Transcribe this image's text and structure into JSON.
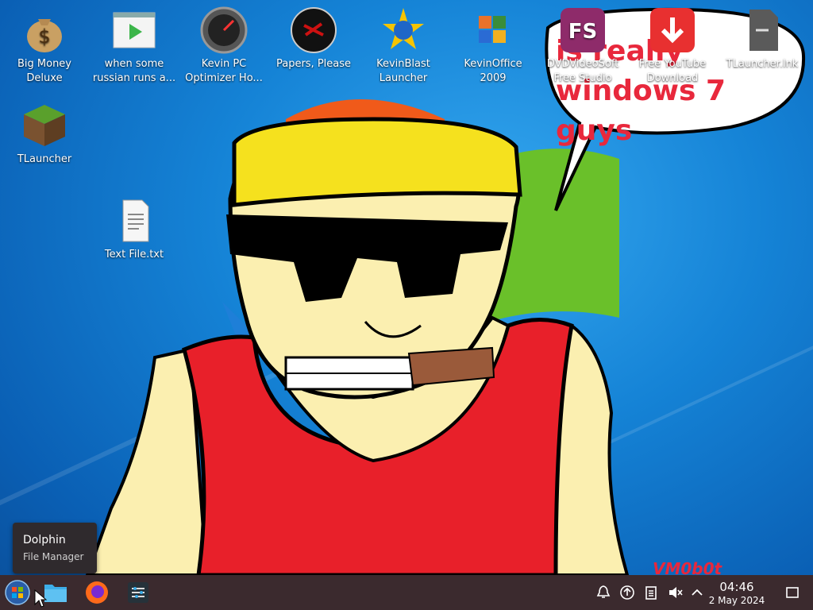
{
  "desktop": {
    "icons": [
      {
        "label": "Big Money Deluxe"
      },
      {
        "label": "when some russian runs a..."
      },
      {
        "label": "Kevin PC Optimizer Ho..."
      },
      {
        "label": "Papers, Please"
      },
      {
        "label": "KevinBlast Launcher"
      },
      {
        "label": "KevinOffice 2009"
      },
      {
        "label": "DVDVideoSoft Free Studio"
      },
      {
        "label": "Free YouTube Download"
      },
      {
        "label": "TLauncher.lnk"
      },
      {
        "label": "TLauncher"
      },
      {
        "label": "Text File.txt"
      }
    ],
    "speech_bubble_text": "is really windows 7 guys",
    "signature": "VM0b0t"
  },
  "tooltip": {
    "title": "Dolphin",
    "subtitle": "File Manager"
  },
  "taskbar": {
    "time": "04:46",
    "date": "2 May 2024"
  },
  "colors": {
    "taskbar": "#3b2a2e",
    "desktop_blue": "#1583d6",
    "speech_text": "#e8283c"
  }
}
